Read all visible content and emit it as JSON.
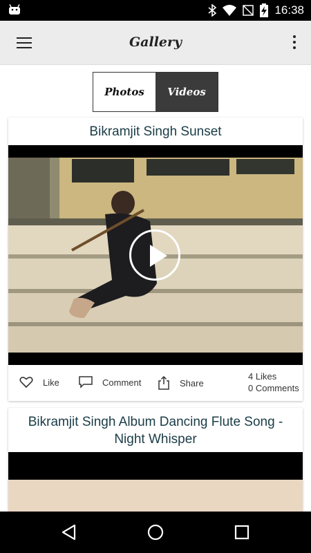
{
  "status_bar": {
    "time": "16:38",
    "icons": [
      "android-icon",
      "bluetooth-icon",
      "wifi-icon",
      "no-sim-icon",
      "battery-charging-icon"
    ]
  },
  "app_bar": {
    "title": "Gallery",
    "icons": [
      "hamburger-menu-icon",
      "overflow-menu-icon"
    ]
  },
  "tabs": [
    {
      "label": "Photos",
      "selected": false
    },
    {
      "label": "Videos",
      "selected": true
    }
  ],
  "colors": {
    "title_text": "#1a3c46",
    "selected_tab_bg": "#3b3b3b",
    "app_bar_bg": "#ececec"
  },
  "videos": [
    {
      "title": "Bikramjit Singh Sunset",
      "actions": {
        "like": "Like",
        "comment": "Comment",
        "share": "Share"
      },
      "likes": "4 Likes",
      "comments": "0 Comments",
      "icons": [
        "heart-icon",
        "comment-icon",
        "share-icon",
        "play-icon"
      ]
    },
    {
      "title": "Bikramjit Singh Album Dancing Flute Song - Night Whisper"
    }
  ],
  "nav_bar": {
    "icons": [
      "back-icon",
      "home-icon",
      "recent-apps-icon"
    ]
  }
}
